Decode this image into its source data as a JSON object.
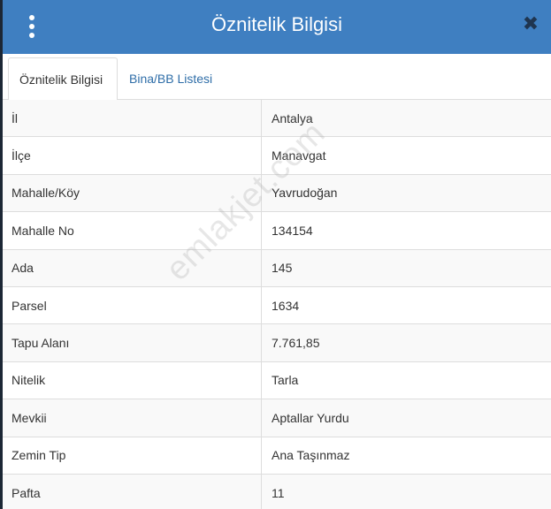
{
  "header": {
    "title": "Öznitelik Bilgisi",
    "menu_icon": "vertical-dots-icon",
    "close_icon": "close-icon",
    "background": "#3f7fc1"
  },
  "tabs": [
    {
      "label": "Öznitelik Bilgisi",
      "active": true
    },
    {
      "label": "Bina/BB Listesi",
      "active": false
    }
  ],
  "attributes": [
    {
      "key": "İl",
      "value": "Antalya"
    },
    {
      "key": "İlçe",
      "value": "Manavgat"
    },
    {
      "key": "Mahalle/Köy",
      "value": "Yavrudoğan"
    },
    {
      "key": "Mahalle No",
      "value": "134154"
    },
    {
      "key": "Ada",
      "value": "145"
    },
    {
      "key": "Parsel",
      "value": "1634"
    },
    {
      "key": "Tapu Alanı",
      "value": "7.761,85"
    },
    {
      "key": "Nitelik",
      "value": "Tarla"
    },
    {
      "key": "Mevkii",
      "value": "Aptallar Yurdu"
    },
    {
      "key": "Zemin Tip",
      "value": "Ana Taşınmaz"
    },
    {
      "key": "Pafta",
      "value": "11"
    }
  ],
  "watermark": "emlakjet.com"
}
